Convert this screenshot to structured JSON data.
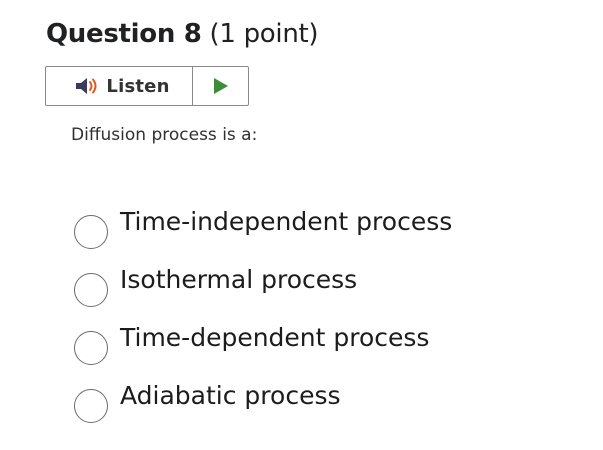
{
  "question": {
    "number_label": "Question 8",
    "points_label": "(1 point)",
    "prompt": "Diffusion process is a:"
  },
  "listen_widget": {
    "listen_label": "Listen",
    "speaker_icon": "speaker-icon",
    "play_icon": "play-icon",
    "play_color": "#3c8c3c",
    "speaker_color": "#3a3a5a",
    "wave_color": "#e05a1e"
  },
  "options": [
    {
      "label": "Time-independent process",
      "selected": false
    },
    {
      "label": "Isothermal process",
      "selected": false
    },
    {
      "label": "Time-dependent process",
      "selected": false
    },
    {
      "label": "Adiabatic process",
      "selected": false
    }
  ]
}
